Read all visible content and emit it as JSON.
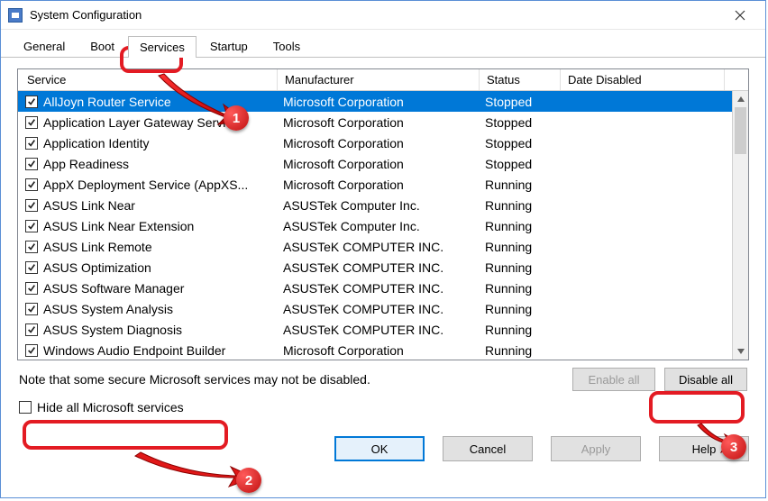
{
  "window": {
    "title": "System Configuration"
  },
  "tabs": [
    "General",
    "Boot",
    "Services",
    "Startup",
    "Tools"
  ],
  "active_tab": 2,
  "columns": {
    "service": "Service",
    "mfr": "Manufacturer",
    "status": "Status",
    "date": "Date Disabled"
  },
  "rows": [
    {
      "checked": true,
      "service": "AllJoyn Router Service",
      "mfr": "Microsoft Corporation",
      "status": "Stopped",
      "selected": true
    },
    {
      "checked": true,
      "service": "Application Layer Gateway Service",
      "mfr": "Microsoft Corporation",
      "status": "Stopped"
    },
    {
      "checked": true,
      "service": "Application Identity",
      "mfr": "Microsoft Corporation",
      "status": "Stopped"
    },
    {
      "checked": true,
      "service": "App Readiness",
      "mfr": "Microsoft Corporation",
      "status": "Stopped"
    },
    {
      "checked": true,
      "service": "AppX Deployment Service (AppXS...",
      "mfr": "Microsoft Corporation",
      "status": "Running"
    },
    {
      "checked": true,
      "service": "ASUS Link Near",
      "mfr": "ASUSTek Computer Inc.",
      "status": "Running"
    },
    {
      "checked": true,
      "service": "ASUS Link Near Extension",
      "mfr": "ASUSTek Computer Inc.",
      "status": "Running"
    },
    {
      "checked": true,
      "service": "ASUS Link Remote",
      "mfr": "ASUSTeK COMPUTER INC.",
      "status": "Running"
    },
    {
      "checked": true,
      "service": "ASUS Optimization",
      "mfr": "ASUSTeK COMPUTER INC.",
      "status": "Running"
    },
    {
      "checked": true,
      "service": "ASUS Software Manager",
      "mfr": "ASUSTeK COMPUTER INC.",
      "status": "Running"
    },
    {
      "checked": true,
      "service": "ASUS System Analysis",
      "mfr": "ASUSTeK COMPUTER INC.",
      "status": "Running"
    },
    {
      "checked": true,
      "service": "ASUS System Diagnosis",
      "mfr": "ASUSTeK COMPUTER INC.",
      "status": "Running"
    },
    {
      "checked": true,
      "service": "Windows Audio Endpoint Builder",
      "mfr": "Microsoft Corporation",
      "status": "Running"
    }
  ],
  "note": "Note that some secure Microsoft services may not be disabled.",
  "buttons": {
    "enable_all": "Enable all",
    "disable_all": "Disable all",
    "ok": "OK",
    "cancel": "Cancel",
    "apply": "Apply",
    "help": "Help"
  },
  "hide_checkbox": {
    "label": "Hide all Microsoft services",
    "checked": false
  },
  "annotations": {
    "1": "1",
    "2": "2",
    "3": "3"
  }
}
